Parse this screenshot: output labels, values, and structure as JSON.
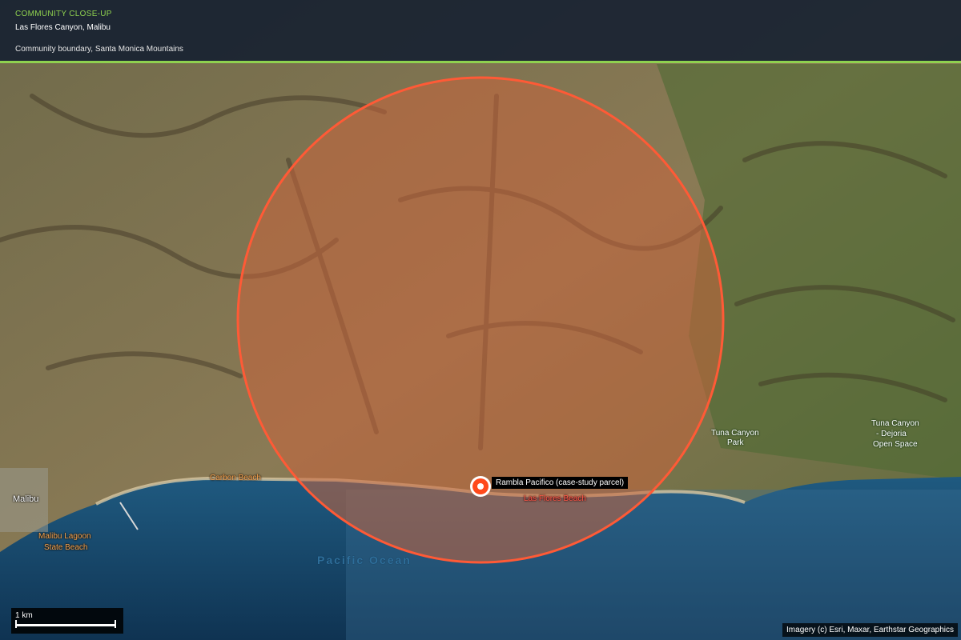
{
  "header": {
    "kicker": "COMMUNITY CLOSE-UP",
    "title": "Las Flores Canyon, Malibu",
    "subtitle": "Community boundary, Santa Monica Mountains"
  },
  "map": {
    "colors": {
      "boundary": "#ff5a36",
      "boundary_fill": "#c8643c",
      "ocean": "#1d4f78",
      "land": "#8a7a55",
      "header_accent": "#8fd14f"
    },
    "marker": {
      "label": "Rambla Pacifico (case-study parcel)",
      "icon": "target-marker-icon"
    },
    "labels": {
      "carbon_beach": "Carbon Beach",
      "las_flores_beach": "Las Flores Beach",
      "malibu": "Malibu",
      "malibu_lagoon_1": "Malibu Lagoon",
      "malibu_lagoon_2": "State Beach",
      "tuna_park_1": "Tuna Canyon",
      "tuna_park_2": "Park",
      "tuna_open_1": "Tuna Canyon",
      "tuna_open_2": "- Dejoria",
      "tuna_open_3": "Open Space",
      "ocean": "Pacific Ocean"
    },
    "scale_label": "1 km",
    "attribution": "Imagery (c) Esri, Maxar, Earthstar Geographics"
  }
}
